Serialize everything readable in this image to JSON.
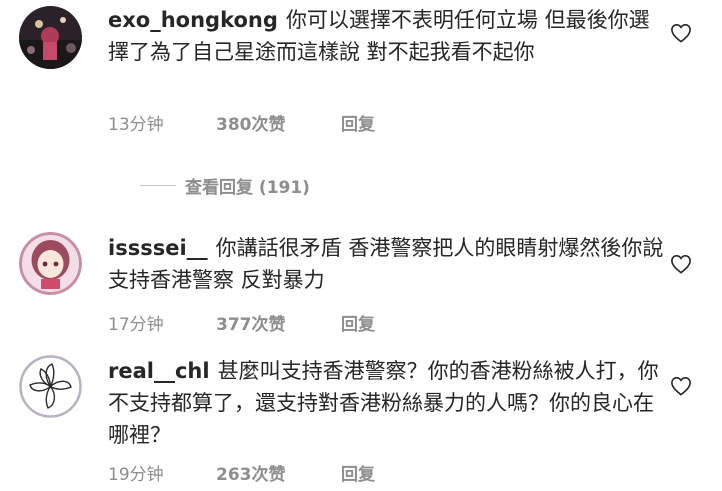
{
  "comments": [
    {
      "username": "exo_hongkong",
      "text": "你可以選擇不表明任何立場 但最後你選擇了為了自己星途而這樣說 對不起我看不起你",
      "time": "13分钟",
      "likes": "380次赞",
      "reply": "回复",
      "avatar_icon": "avatar-dark-photo-icon"
    },
    {
      "username": "issssei__",
      "text": "你講話很矛盾 香港警察把人的眼睛射爆然後你說支持香港警察 反對暴力",
      "time": "17分钟",
      "likes": "377次赞",
      "reply": "回复",
      "avatar_icon": "avatar-anime-girl-icon"
    },
    {
      "username": "real__chl",
      "text": "甚麼叫支持香港警察？你的香港粉絲被人打，你不支持都算了，還支持對香港粉絲暴力的人嗎？你的良心在哪裡？",
      "time": "19分钟",
      "likes": "263次赞",
      "reply": "回复",
      "avatar_icon": "avatar-bauhinia-flower-icon"
    }
  ],
  "view_replies": "查看回复 (191)",
  "colors": {
    "text": "#262626",
    "secondary": "#8e8e8e",
    "divider": "#c7c7c7"
  },
  "icons": {
    "like": "heart-outline-icon"
  }
}
